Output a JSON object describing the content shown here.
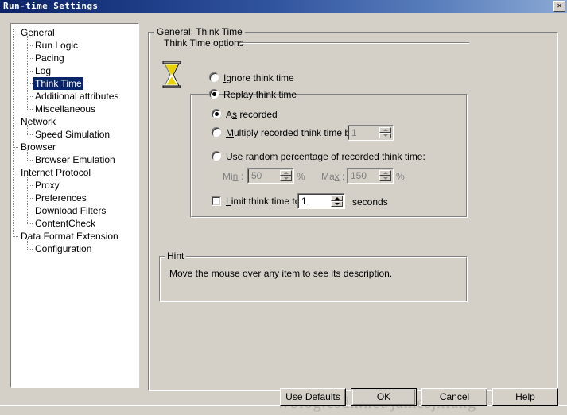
{
  "window": {
    "title": "Run-time Settings",
    "close_label": "✕"
  },
  "tree": {
    "nodes": [
      {
        "label": "General",
        "depth": 0,
        "selected": false
      },
      {
        "label": "Run Logic",
        "depth": 1,
        "selected": false
      },
      {
        "label": "Pacing",
        "depth": 1,
        "selected": false
      },
      {
        "label": "Log",
        "depth": 1,
        "selected": false
      },
      {
        "label": "Think Time",
        "depth": 1,
        "selected": true
      },
      {
        "label": "Additional attributes",
        "depth": 1,
        "selected": false
      },
      {
        "label": "Miscellaneous",
        "depth": 1,
        "selected": false
      },
      {
        "label": "Network",
        "depth": 0,
        "selected": false
      },
      {
        "label": "Speed Simulation",
        "depth": 1,
        "selected": false
      },
      {
        "label": "Browser",
        "depth": 0,
        "selected": false
      },
      {
        "label": "Browser Emulation",
        "depth": 1,
        "selected": false
      },
      {
        "label": "Internet Protocol",
        "depth": 0,
        "selected": false
      },
      {
        "label": "Proxy",
        "depth": 1,
        "selected": false
      },
      {
        "label": "Preferences",
        "depth": 1,
        "selected": false
      },
      {
        "label": "Download Filters",
        "depth": 1,
        "selected": false
      },
      {
        "label": "ContentCheck",
        "depth": 1,
        "selected": false
      },
      {
        "label": "Data Format Extension",
        "depth": 0,
        "selected": false
      },
      {
        "label": "Configuration",
        "depth": 1,
        "selected": false
      }
    ]
  },
  "main": {
    "page_group_title": "General: Think Time",
    "options_section_label": "Think Time options",
    "icon": "hourglass-icon",
    "ignore_think_time": {
      "label": "Ignore think time",
      "accel": "I",
      "checked": false
    },
    "replay_think_time": {
      "label": "Replay think time",
      "accel": "R",
      "checked": true
    },
    "as_recorded": {
      "label": "As recorded",
      "accel": "s",
      "checked": true
    },
    "multiply": {
      "label": "Multiply recorded think time by:",
      "accel": "M",
      "checked": false,
      "value": "1",
      "enabled": false
    },
    "use_random": {
      "label": "Use random percentage of recorded think time:",
      "accel": "e",
      "checked": false
    },
    "random_min": {
      "label": "Min :",
      "accel": "n",
      "value": "50",
      "unit": "%",
      "enabled": false
    },
    "random_max": {
      "label": "Max :",
      "accel": "x",
      "value": "150",
      "unit": "%",
      "enabled": false
    },
    "limit_think_time": {
      "label": "Limit think time to:",
      "accel": "L",
      "checked": false,
      "value": "1",
      "unit": "seconds"
    },
    "hint": {
      "title": "Hint",
      "text": "Move the mouse over any item to see its description."
    }
  },
  "buttons": {
    "use_defaults": {
      "label": "Use Defaults",
      "accel": "U"
    },
    "ok": {
      "label": "OK",
      "accel": ""
    },
    "cancel": {
      "label": "Cancel",
      "accel": ""
    },
    "help": {
      "label": "Help",
      "accel": "H"
    }
  },
  "watermark": {
    "text": "//blog.csdn.net/jamesjxiang"
  },
  "colors": {
    "face": "#d4d0c8",
    "title_left": "#0b2265",
    "title_right": "#8ba9d4",
    "selection": "#0a246a",
    "disabled_text": "#808080",
    "hourglass_sand": "#e8d400"
  }
}
